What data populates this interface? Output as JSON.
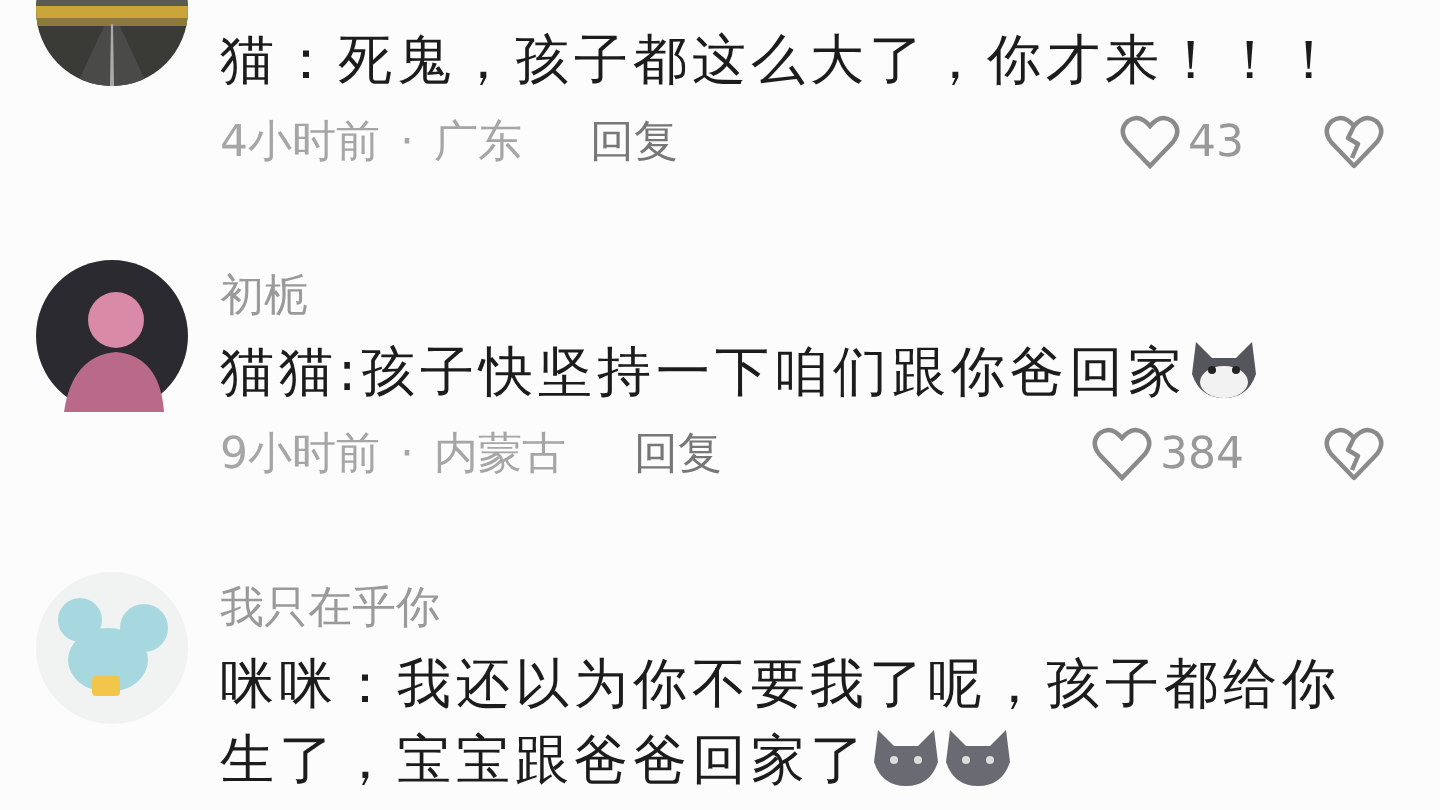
{
  "comments": [
    {
      "text": "猫：死鬼，孩子都这么大了，你才来！！！",
      "time": "4小时前",
      "separator": "·",
      "location": "广东",
      "reply": "回复",
      "likes": "43",
      "liked": false
    },
    {
      "username": "初栀",
      "avatar": {
        "kind": "figure"
      },
      "text": "猫猫:孩子快坚持一下咱们跟你爸回家",
      "stickers": [
        {
          "kind": "husky"
        }
      ],
      "time": "9小时前",
      "separator": "·",
      "location": "内蒙古",
      "reply": "回复",
      "likes": "384",
      "liked": false
    },
    {
      "username": "我只在乎你",
      "avatar": {
        "kind": "mouse"
      },
      "text": "咪咪：我还以为你不要我了呢，孩子都给你生了，宝宝跟爸爸回家了",
      "stickers": [
        {
          "kind": "cat"
        },
        {
          "kind": "cat"
        }
      ]
    }
  ]
}
